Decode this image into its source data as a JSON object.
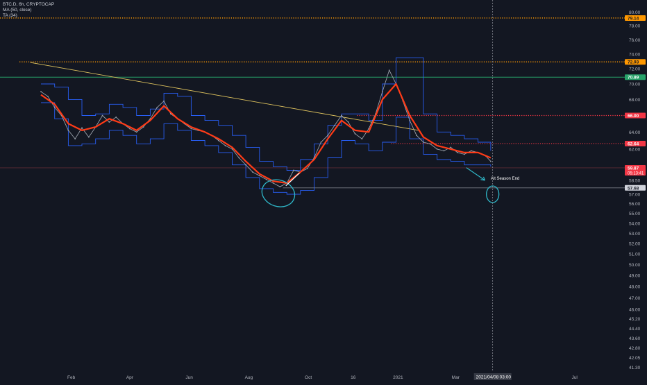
{
  "legend": {
    "symbol_line": "BTC.D, 6h, CRYPTOCAP",
    "ma_line": "MA (50, close)",
    "ta_line": "TA (34)"
  },
  "annotation_text": "Alt Season End",
  "cursor_time_label": "2021/04/08",
  "cursor_clock_label": "03:00",
  "colors": {
    "background": "#131722",
    "price": "#9aa0aa",
    "ma": "#ff3b17",
    "channel": "#2962ff",
    "trend": "#e0c45e",
    "green_line": "#26a269",
    "red_dotted": "#f23645",
    "orange_dotted": "#ff9800",
    "annotation": "#2fb8c9",
    "axis_text": "#b2b5be"
  },
  "chart_data": {
    "type": "line",
    "title": "BTC.D, 6h, CRYPTOCAP",
    "xlabel": "",
    "ylabel": "",
    "y_scale": "log",
    "ylim": [
      41.0,
      81.0
    ],
    "xlim": [
      "2019-11-20",
      "2021-08-20"
    ],
    "x_ticks": [
      {
        "label": "Feb",
        "date": "2020-02-01"
      },
      {
        "label": "Apr",
        "date": "2020-04-01"
      },
      {
        "label": "Jun",
        "date": "2020-06-01"
      },
      {
        "label": "Aug",
        "date": "2020-08-01"
      },
      {
        "label": "Oct",
        "date": "2020-10-01"
      },
      {
        "label": "16",
        "date": "2020-11-16"
      },
      {
        "label": "2021",
        "date": "2021-01-01"
      },
      {
        "label": "Mar",
        "date": "2021-03-01"
      },
      {
        "label": "Jul",
        "date": "2021-07-01"
      }
    ],
    "y_ticks": [
      80.0,
      78.0,
      76.0,
      74.0,
      72.0,
      70.0,
      68.0,
      66.0,
      64.0,
      62.0,
      60.0,
      58.5,
      57.0,
      56.0,
      55.0,
      54.0,
      53.0,
      52.0,
      51.0,
      50.0,
      49.0,
      48.0,
      47.0,
      46.0,
      45.2,
      44.4,
      43.6,
      42.8,
      42.05,
      41.3
    ],
    "series": [
      {
        "name": "BTC.D",
        "style": "price",
        "x": [
          "2020-01-01",
          "2020-01-08",
          "2020-01-15",
          "2020-01-22",
          "2020-01-29",
          "2020-02-05",
          "2020-02-12",
          "2020-02-19",
          "2020-02-26",
          "2020-03-04",
          "2020-03-11",
          "2020-03-18",
          "2020-03-25",
          "2020-04-01",
          "2020-04-08",
          "2020-04-15",
          "2020-04-22",
          "2020-04-29",
          "2020-05-06",
          "2020-05-13",
          "2020-05-20",
          "2020-05-27",
          "2020-06-03",
          "2020-06-10",
          "2020-06-17",
          "2020-06-24",
          "2020-07-01",
          "2020-07-08",
          "2020-07-15",
          "2020-07-22",
          "2020-07-29",
          "2020-08-05",
          "2020-08-12",
          "2020-08-19",
          "2020-08-26",
          "2020-09-02",
          "2020-09-09",
          "2020-09-16",
          "2020-09-23",
          "2020-09-30",
          "2020-10-07",
          "2020-10-14",
          "2020-10-21",
          "2020-10-28",
          "2020-11-04",
          "2020-11-11",
          "2020-11-18",
          "2020-11-25",
          "2020-12-02",
          "2020-12-09",
          "2020-12-16",
          "2020-12-23",
          "2020-12-30",
          "2021-01-06",
          "2021-01-13",
          "2021-01-20",
          "2021-01-27",
          "2021-02-03",
          "2021-02-10",
          "2021-02-17",
          "2021-02-24",
          "2021-03-03",
          "2021-03-10",
          "2021-03-17",
          "2021-03-24",
          "2021-04-01",
          "2021-04-06"
        ],
        "values": [
          69.0,
          68.4,
          67.0,
          66.0,
          64.2,
          63.2,
          64.5,
          63.4,
          64.6,
          66.0,
          65.2,
          65.8,
          65.0,
          64.4,
          64.0,
          64.6,
          65.6,
          67.0,
          67.8,
          66.2,
          65.6,
          65.0,
          64.4,
          64.2,
          64.0,
          63.6,
          63.0,
          62.4,
          62.0,
          61.0,
          60.2,
          59.4,
          59.0,
          58.6,
          58.2,
          57.8,
          58.2,
          59.6,
          59.4,
          59.8,
          61.0,
          62.8,
          63.6,
          64.8,
          66.0,
          65.2,
          63.8,
          63.2,
          64.4,
          66.2,
          69.0,
          71.8,
          70.0,
          67.8,
          65.4,
          63.6,
          62.8,
          62.6,
          62.0,
          61.8,
          62.2,
          61.6,
          61.4,
          61.8,
          61.6,
          61.2,
          60.6
        ]
      },
      {
        "name": "MA (50, close)",
        "style": "ma",
        "x": [
          "2020-01-01",
          "2020-01-15",
          "2020-01-29",
          "2020-02-12",
          "2020-02-26",
          "2020-03-11",
          "2020-03-25",
          "2020-04-08",
          "2020-04-22",
          "2020-05-06",
          "2020-05-20",
          "2020-06-03",
          "2020-06-17",
          "2020-07-01",
          "2020-07-15",
          "2020-07-29",
          "2020-08-12",
          "2020-08-26",
          "2020-09-09",
          "2020-09-23",
          "2020-10-07",
          "2020-10-21",
          "2020-11-04",
          "2020-11-18",
          "2020-12-02",
          "2020-12-16",
          "2020-12-30",
          "2021-01-13",
          "2021-01-27",
          "2021-02-10",
          "2021-02-24",
          "2021-03-10",
          "2021-03-24",
          "2021-04-06"
        ],
        "values": [
          68.6,
          67.4,
          65.0,
          64.2,
          64.6,
          65.6,
          65.0,
          64.2,
          65.4,
          67.2,
          65.6,
          64.6,
          64.0,
          63.2,
          62.2,
          60.6,
          59.2,
          58.4,
          58.2,
          59.4,
          60.8,
          63.2,
          65.4,
          64.2,
          64.0,
          68.0,
          70.0,
          66.0,
          63.4,
          62.4,
          62.0,
          61.6,
          61.6,
          61.0
        ]
      },
      {
        "name": "TA (34) upper",
        "style": "channel",
        "x": [
          "2020-01-01",
          "2020-01-15",
          "2020-01-29",
          "2020-02-12",
          "2020-02-26",
          "2020-03-11",
          "2020-03-25",
          "2020-04-08",
          "2020-04-22",
          "2020-05-06",
          "2020-05-20",
          "2020-06-03",
          "2020-06-17",
          "2020-07-01",
          "2020-07-15",
          "2020-07-29",
          "2020-08-12",
          "2020-08-26",
          "2020-09-09",
          "2020-09-23",
          "2020-10-07",
          "2020-10-21",
          "2020-11-04",
          "2020-11-18",
          "2020-12-02",
          "2020-12-16",
          "2020-12-30",
          "2021-01-13",
          "2021-01-27",
          "2021-02-10",
          "2021-02-24",
          "2021-03-10",
          "2021-03-24",
          "2021-04-06"
        ],
        "values": [
          70.0,
          69.6,
          68.0,
          66.0,
          66.2,
          67.4,
          67.0,
          66.0,
          66.8,
          68.8,
          68.4,
          66.0,
          65.4,
          64.8,
          63.6,
          62.2,
          60.6,
          60.0,
          59.6,
          60.8,
          62.6,
          64.8,
          66.2,
          66.2,
          65.4,
          70.0,
          73.5,
          73.5,
          66.2,
          64.0,
          63.6,
          63.2,
          62.8,
          61.8
        ]
      },
      {
        "name": "TA (34) lower",
        "style": "channel",
        "x": [
          "2020-01-01",
          "2020-01-15",
          "2020-01-29",
          "2020-02-12",
          "2020-02-26",
          "2020-03-11",
          "2020-03-25",
          "2020-04-08",
          "2020-04-22",
          "2020-05-06",
          "2020-05-20",
          "2020-06-03",
          "2020-06-17",
          "2020-07-01",
          "2020-07-15",
          "2020-07-29",
          "2020-08-12",
          "2020-08-26",
          "2020-09-09",
          "2020-09-23",
          "2020-10-07",
          "2020-10-21",
          "2020-11-04",
          "2020-11-18",
          "2020-12-02",
          "2020-12-16",
          "2020-12-30",
          "2021-01-13",
          "2021-01-27",
          "2021-02-10",
          "2021-02-24",
          "2021-03-10",
          "2021-03-24",
          "2021-04-06"
        ],
        "values": [
          67.6,
          65.6,
          62.4,
          62.6,
          63.2,
          64.2,
          63.6,
          62.6,
          63.2,
          65.0,
          64.2,
          63.0,
          62.4,
          61.6,
          60.2,
          58.8,
          57.6,
          57.2,
          57.0,
          57.4,
          58.8,
          61.0,
          63.0,
          62.6,
          61.8,
          62.8,
          65.8,
          63.2,
          61.4,
          60.8,
          60.6,
          60.2,
          60.2,
          60.0
        ]
      }
    ],
    "trend_line": {
      "x": [
        "2019-12-21",
        "2021-01-22"
      ],
      "y": [
        72.85,
        64.2
      ]
    },
    "horizontal_levels": [
      {
        "value": 79.14,
        "label": "79.14",
        "style": "orange_dotted",
        "from": "2019-11-20"
      },
      {
        "value": 72.93,
        "label": "72.93",
        "style": "orange_dotted",
        "from": "2019-12-10"
      },
      {
        "value": 70.89,
        "label": "70.89",
        "style": "green_solid",
        "from": "2019-11-20"
      },
      {
        "value": 66.0,
        "label": "66.00",
        "style": "red_dotted",
        "from": "2020-11-20"
      },
      {
        "value": 62.64,
        "label": "62.64",
        "style": "red_dotted",
        "from": "2020-12-25"
      },
      {
        "value": 59.87,
        "label": "59.87",
        "sublabel": "05:13:41",
        "style": "last_price",
        "from": "2019-11-20"
      },
      {
        "value": 57.68,
        "label": "57.68",
        "style": "gray_solid",
        "from": "2020-09-05"
      }
    ],
    "cursor_x": "2021-04-08",
    "grid": false,
    "legend": "top-left"
  }
}
